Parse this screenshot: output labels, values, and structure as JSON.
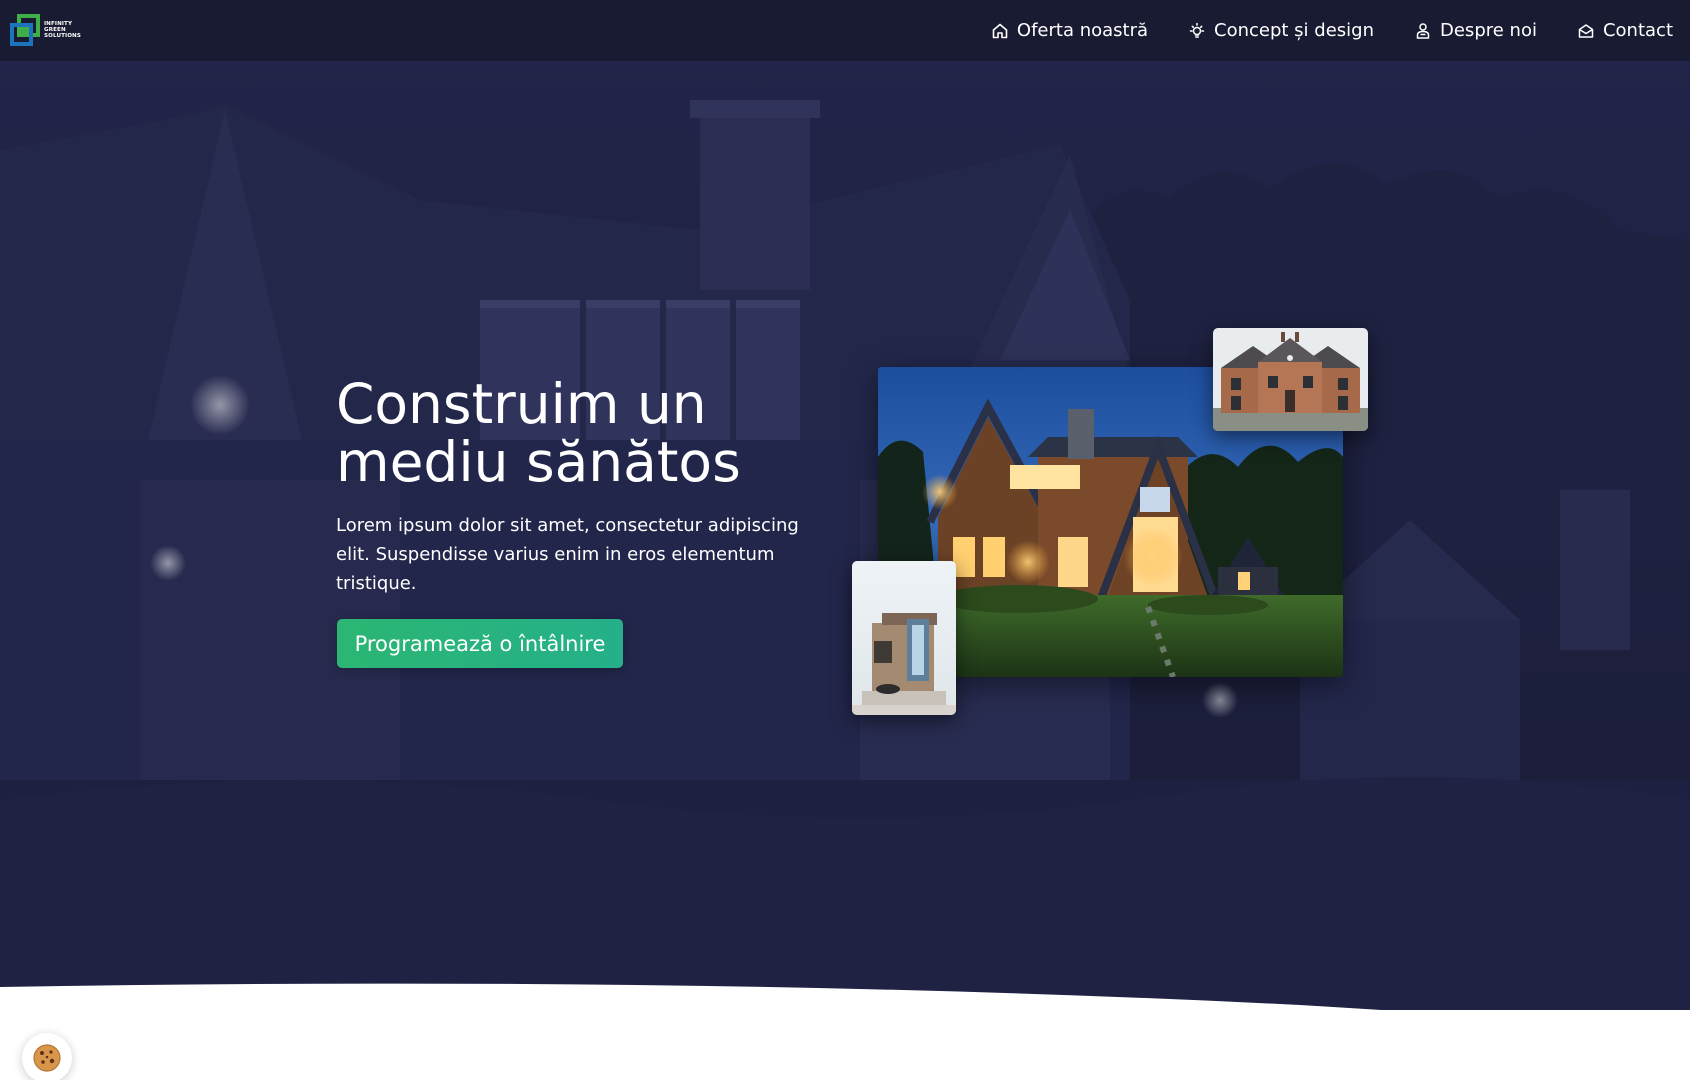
{
  "brand": {
    "logo_lines": [
      "INFINITY",
      "GREEN",
      "SOLUTIONS"
    ],
    "colors": {
      "nav_bg": "#191b33",
      "hero_overlay": "#1b1d3b",
      "cta_green": "#2bb673",
      "logo_green": "#3fae49",
      "logo_blue": "#1c75bc",
      "text": "#ffffff"
    }
  },
  "nav": {
    "items": [
      {
        "label": "Oferta noastră",
        "icon": "home-icon"
      },
      {
        "label": "Concept și design",
        "icon": "lightbulb-icon"
      },
      {
        "label": "Despre noi",
        "icon": "users-icon"
      },
      {
        "label": "Contact",
        "icon": "envelope-open-icon"
      }
    ]
  },
  "hero": {
    "title_line1": "Construim un",
    "title_line2": "mediu sănătos",
    "description": "Lorem ipsum dolor sit amet, consectetur adipiscing elit. Suspendisse varius enim in eros elementum tristique.",
    "cta_label": "Programează o întâlnire"
  },
  "images": {
    "main": "house-at-dusk-image",
    "top_right": "brick-townhouse-image",
    "bottom_left": "modern-building-image"
  },
  "cookie": {
    "icon": "cookie-icon"
  }
}
